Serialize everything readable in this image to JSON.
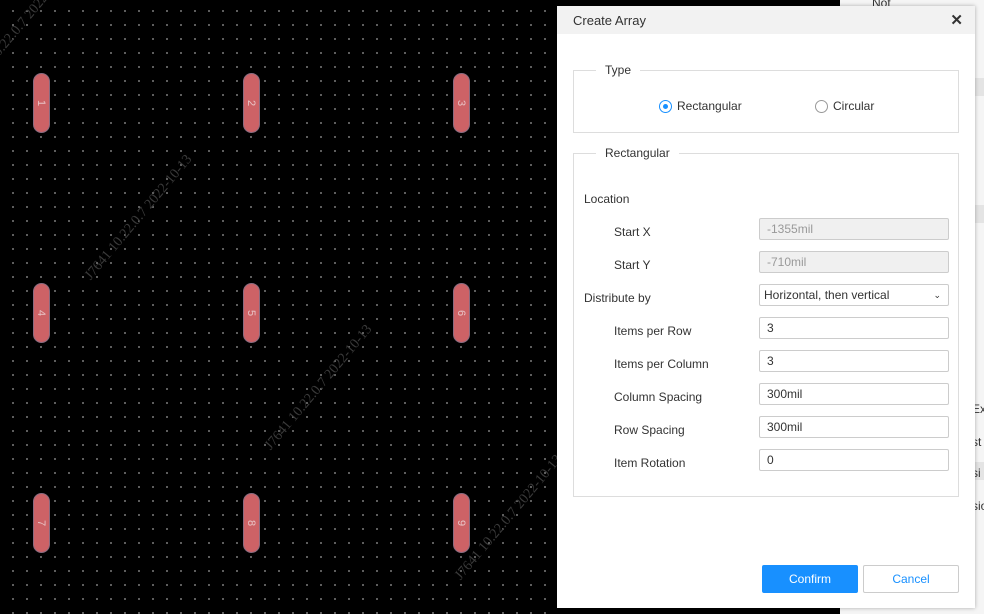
{
  "canvas": {
    "pads": [
      "1",
      "2",
      "3",
      "4",
      "5",
      "6",
      "7",
      "8",
      "9"
    ],
    "watermark": "J7641 10.22.0.7 2022-10-13",
    "pad_color": "#cd6266"
  },
  "side_panel": {
    "texts": [
      "Not",
      "Ex",
      "st",
      "si",
      "sio"
    ]
  },
  "dialog": {
    "title": "Create Array",
    "close_icon": "close-icon",
    "type": {
      "legend": "Type",
      "options": [
        {
          "label": "Rectangular",
          "selected": true
        },
        {
          "label": "Circular",
          "selected": false
        }
      ]
    },
    "rect": {
      "legend": "Rectangular",
      "location": "Location",
      "start_x": {
        "label": "Start X",
        "value": "-1355mil"
      },
      "start_y": {
        "label": "Start Y",
        "value": "-710mil"
      },
      "distribute": {
        "label": "Distribute by",
        "value": "Horizontal, then vertical"
      },
      "items_row": {
        "label": "Items per Row",
        "value": "3"
      },
      "items_col": {
        "label": "Items per Column",
        "value": "3"
      },
      "col_spacing": {
        "label": "Column Spacing",
        "value": "300mil"
      },
      "row_spacing": {
        "label": "Row Spacing",
        "value": "300mil"
      },
      "rotation": {
        "label": "Item Rotation",
        "value": "0"
      }
    },
    "confirm": "Confirm",
    "cancel": "Cancel",
    "accent": "#1890ff"
  }
}
